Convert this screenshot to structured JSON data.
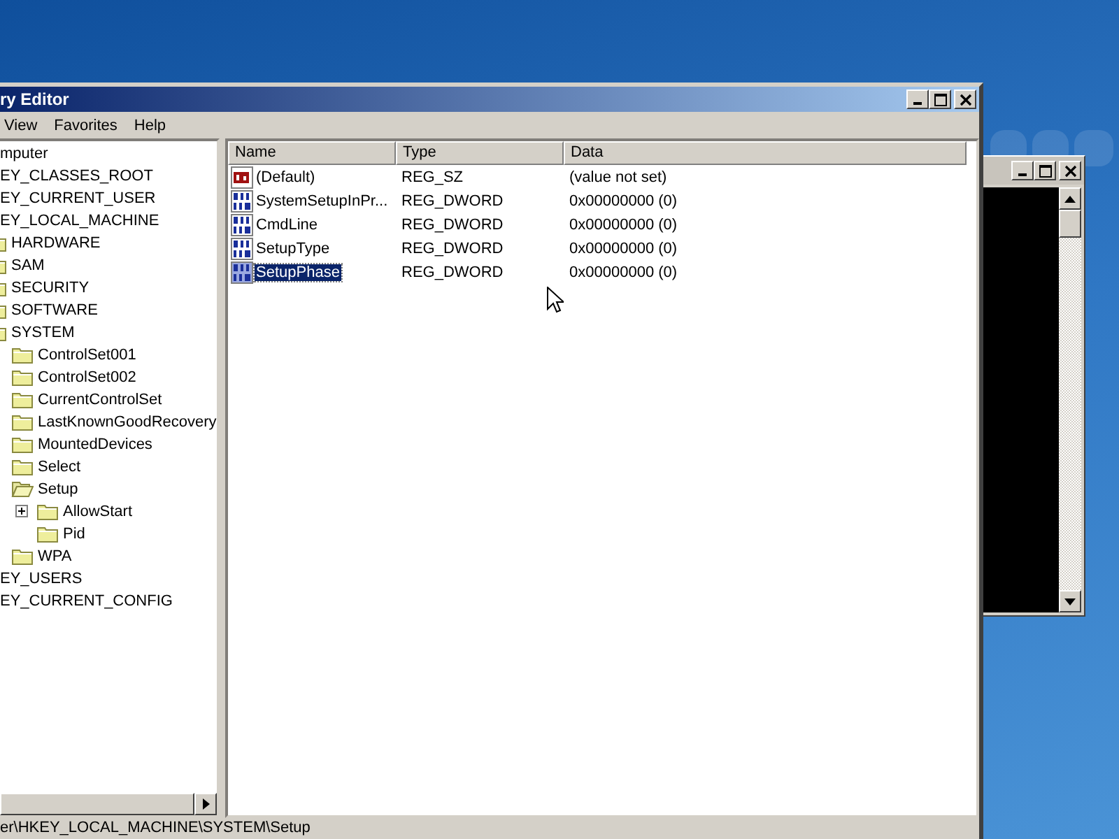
{
  "window": {
    "title": "ry Editor"
  },
  "menu": [
    "View",
    "Favorites",
    "Help"
  ],
  "tree": [
    {
      "label": "mputer",
      "children": [
        {
          "label": "EY_CLASSES_ROOT"
        },
        {
          "label": "EY_CURRENT_USER"
        },
        {
          "label": "EY_LOCAL_MACHINE",
          "children": [
            {
              "label": "HARDWARE",
              "selected": false
            },
            {
              "label": "SAM",
              "selected": false
            },
            {
              "label": "SECURITY",
              "selected": false
            },
            {
              "label": "SOFTWARE",
              "selected": false
            },
            {
              "label": "SYSTEM",
              "selected": false,
              "children": [
                {
                  "label": "ControlSet001",
                  "selected": false
                },
                {
                  "label": "ControlSet002",
                  "selected": false
                },
                {
                  "label": "CurrentControlSet",
                  "selected": false
                },
                {
                  "label": "LastKnownGoodRecovery",
                  "selected": false
                },
                {
                  "label": "MountedDevices",
                  "selected": false
                },
                {
                  "label": "Select",
                  "selected": false
                },
                {
                  "label": "Setup",
                  "selected": true,
                  "children": [
                    {
                      "label": "AllowStart",
                      "selected": false,
                      "collapsed": true
                    },
                    {
                      "label": "Pid",
                      "selected": false,
                      "collapsed": false
                    }
                  ]
                },
                {
                  "label": "WPA",
                  "selected": false
                }
              ]
            }
          ]
        },
        {
          "label": "EY_USERS"
        },
        {
          "label": "EY_CURRENT_CONFIG"
        }
      ]
    }
  ],
  "values_table": {
    "columns": [
      "Name",
      "Type",
      "Data"
    ],
    "rows": [
      {
        "kind": "string",
        "name": "(Default)",
        "type": "REG_SZ",
        "data": "(value not set)",
        "selected": false
      },
      {
        "kind": "dword",
        "name": "SystemSetupInPr...",
        "type": "REG_DWORD",
        "data": "0x00000000 (0)",
        "selected": false
      },
      {
        "kind": "dword",
        "name": "CmdLine",
        "type": "REG_DWORD",
        "data": "0x00000000 (0)",
        "selected": false
      },
      {
        "kind": "dword",
        "name": "SetupType",
        "type": "REG_DWORD",
        "data": "0x00000000 (0)",
        "selected": false
      },
      {
        "kind": "dword",
        "name": "SetupPhase",
        "type": "REG_DWORD",
        "data": "0x00000000 (0)",
        "selected": true
      }
    ]
  },
  "status_bar": "er\\HKEY_LOCAL_MACHINE\\SYSTEM\\Setup"
}
